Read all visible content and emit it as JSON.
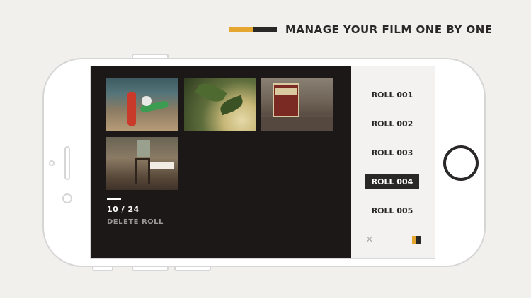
{
  "headline": {
    "text": "MANAGE YOUR FILM ONE BY ONE",
    "accent_color": "#e6a730",
    "dark_color": "#2a2727"
  },
  "gallery": {
    "thumbnails": [
      {
        "name": "child-with-toy-photo"
      },
      {
        "name": "leaves-photo"
      },
      {
        "name": "cable-car-photo"
      },
      {
        "name": "restaurant-interior-photo"
      }
    ],
    "count": "10 / 24",
    "delete_label": "DELETE ROLL"
  },
  "rolls": {
    "items": [
      {
        "label": "ROLL 001",
        "active": false
      },
      {
        "label": "ROLL 002",
        "active": false
      },
      {
        "label": "ROLL 003",
        "active": false
      },
      {
        "label": "ROLL 004",
        "active": true
      },
      {
        "label": "ROLL 005",
        "active": false
      }
    ],
    "close_icon": "×"
  }
}
